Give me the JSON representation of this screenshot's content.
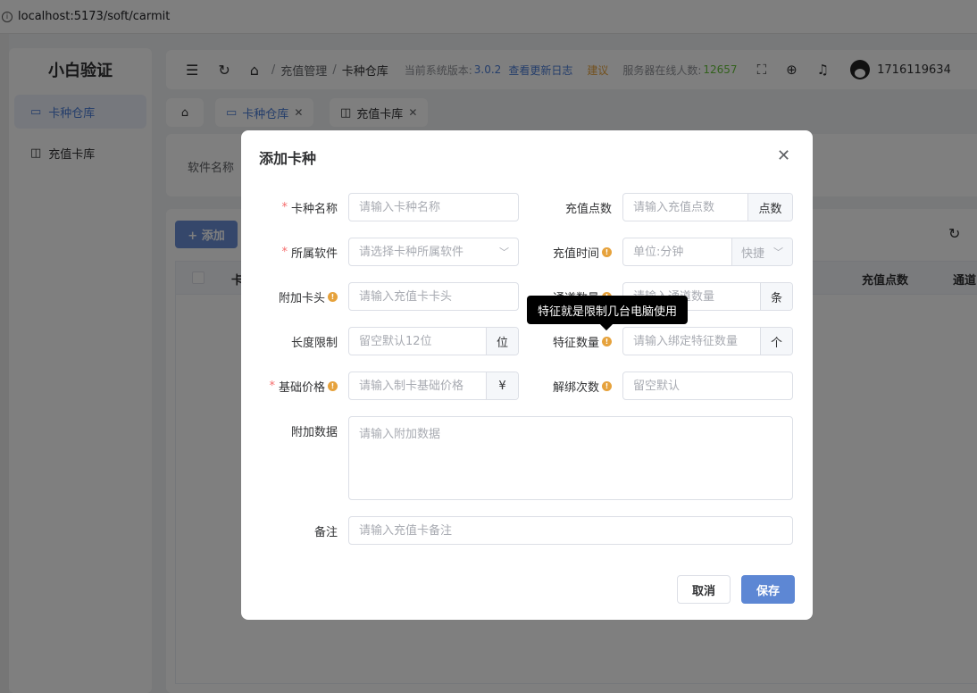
{
  "browser": {
    "url": "localhost:5173/soft/carmit"
  },
  "sidebar": {
    "logo": "小白验证",
    "items": [
      {
        "label": "卡种仓库",
        "icon": "calendar-icon",
        "active": true
      },
      {
        "label": "充值卡库",
        "icon": "bag-icon",
        "active": false
      }
    ]
  },
  "header": {
    "breadcrumb": [
      "充值管理",
      "卡种仓库"
    ],
    "version_label": "当前系统版本:",
    "version": "3.0.2",
    "changelog": "查看更新日志",
    "suggest": "建议",
    "online_label": "服务器在线人数:",
    "online_count": "12657",
    "username": "1716119634"
  },
  "tabs": [
    {
      "label": "卡种仓库",
      "icon": "calendar-icon",
      "active": true
    },
    {
      "label": "充值卡库",
      "icon": "bag-icon",
      "active": false
    }
  ],
  "search": {
    "software_label": "软件名称"
  },
  "table": {
    "add_label": "+ 添加",
    "columns": [
      "卡",
      "充值点数",
      "通道"
    ]
  },
  "dialog": {
    "title": "添加卡种",
    "fields": {
      "card_name": {
        "label": "卡种名称",
        "placeholder": "请输入卡种名称",
        "required": true
      },
      "software": {
        "label": "所属软件",
        "placeholder": "请选择卡种所属软件",
        "required": true
      },
      "prefix": {
        "label": "附加卡头",
        "placeholder": "请输入充值卡卡头"
      },
      "length": {
        "label": "长度限制",
        "placeholder": "留空默认12位",
        "unit": "位"
      },
      "base_price": {
        "label": "基础价格",
        "placeholder": "请输入制卡基础价格",
        "unit": "¥",
        "required": true
      },
      "extra_data": {
        "label": "附加数据",
        "placeholder": "请输入附加数据"
      },
      "remark": {
        "label": "备注",
        "placeholder": "请输入充值卡备注"
      },
      "points": {
        "label": "充值点数",
        "placeholder": "请输入充值点数",
        "unit": "点数"
      },
      "time": {
        "label": "充值时间",
        "placeholder": "单位:分钟",
        "quick": "快捷"
      },
      "channel": {
        "label": "通道数量",
        "placeholder": "请输入通道数量",
        "unit": "条"
      },
      "feature": {
        "label": "特征数量",
        "placeholder": "请输入绑定特征数量",
        "unit": "个"
      },
      "unbind": {
        "label": "解绑次数",
        "placeholder": "留空默认"
      }
    },
    "tooltip": "特征就是限制几台电脑使用",
    "cancel": "取消",
    "save": "保存"
  },
  "colors": {
    "primary": "#5d87d4",
    "required": "#f56c6c",
    "warning": "#e6a23c",
    "success": "#67c23a"
  }
}
